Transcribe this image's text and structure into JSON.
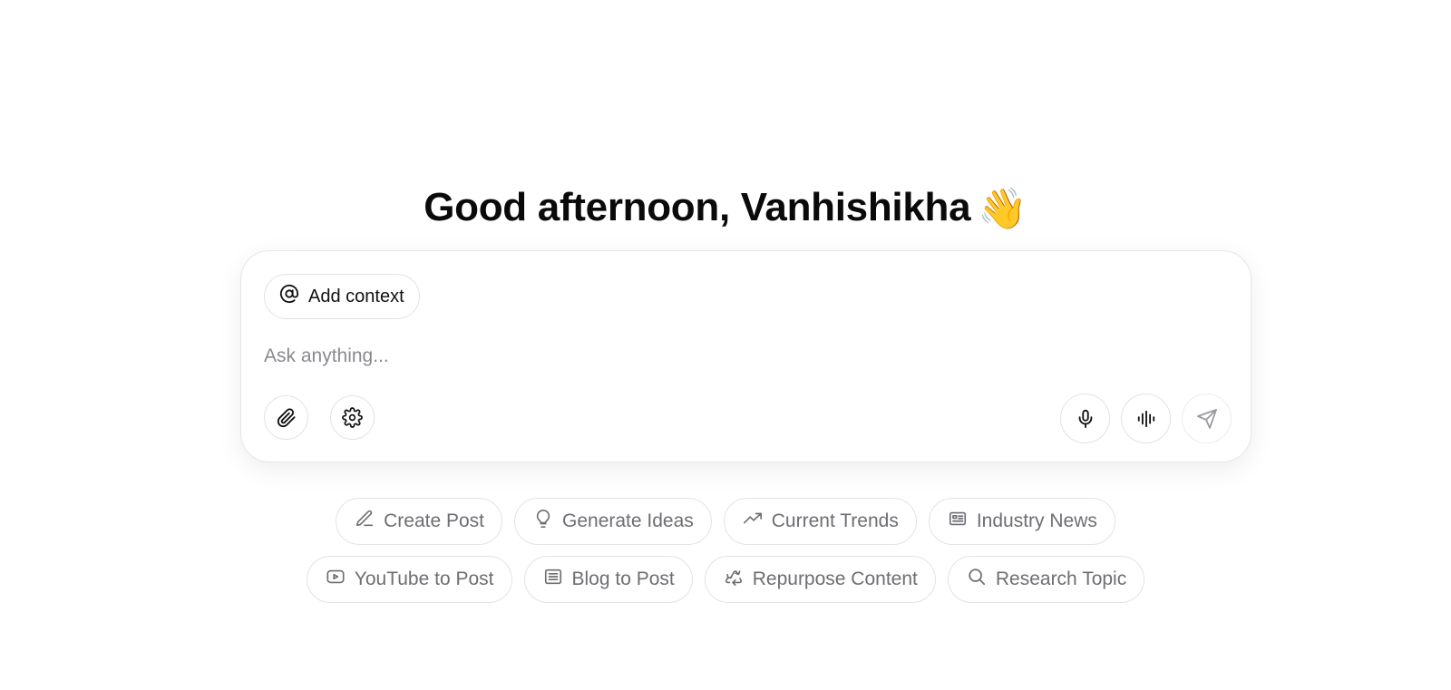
{
  "greeting": {
    "text": "Good afternoon, Vanhishikha",
    "emoji": "👋"
  },
  "composer": {
    "add_context_label": "Add context",
    "add_context_icon": "at-sign-icon",
    "input_placeholder": "Ask anything...",
    "input_value": "",
    "left_tools": [
      {
        "name": "attach",
        "icon": "paperclip-icon"
      },
      {
        "name": "settings",
        "icon": "gear-icon"
      }
    ],
    "right_tools": [
      {
        "name": "microphone",
        "icon": "microphone-icon"
      },
      {
        "name": "voice-mode",
        "icon": "audio-waveform-icon"
      },
      {
        "name": "send",
        "icon": "send-icon"
      }
    ]
  },
  "suggestions": {
    "row1": [
      {
        "label": "Create Post",
        "icon": "pencil-icon"
      },
      {
        "label": "Generate Ideas",
        "icon": "lightbulb-icon"
      },
      {
        "label": "Current Trends",
        "icon": "trending-up-icon"
      },
      {
        "label": "Industry News",
        "icon": "newspaper-icon"
      }
    ],
    "row2": [
      {
        "label": "YouTube to Post",
        "icon": "youtube-icon"
      },
      {
        "label": "Blog to Post",
        "icon": "article-icon"
      },
      {
        "label": "Repurpose Content",
        "icon": "recycle-icon"
      },
      {
        "label": "Research Topic",
        "icon": "search-icon"
      }
    ]
  },
  "colors": {
    "text_primary": "#0a0a0a",
    "text_muted": "#6e6e73",
    "border": "#e3e3e3",
    "background": "#ffffff"
  }
}
